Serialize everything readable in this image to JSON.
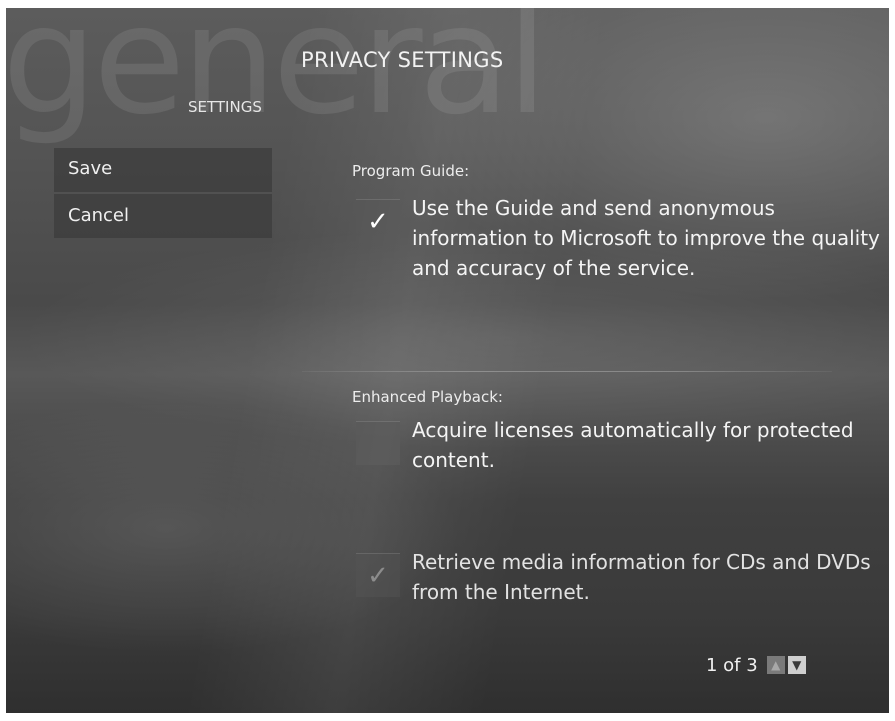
{
  "background_word": "general",
  "header": {
    "title": "PRIVACY SETTINGS",
    "section": "SETTINGS"
  },
  "menu": {
    "items": [
      {
        "label": "Save"
      },
      {
        "label": "Cancel"
      }
    ]
  },
  "groups": [
    {
      "label": "Program Guide:",
      "options": [
        {
          "text": "Use the Guide and send anonymous information to Microsoft to improve the quality and accuracy of the service.",
          "checked": true,
          "enabled": true
        }
      ]
    },
    {
      "label": "Enhanced Playback:",
      "options": [
        {
          "text": "Acquire licenses automatically for protected content.",
          "checked": false,
          "enabled": true
        },
        {
          "text": "Retrieve media information for CDs and DVDs from the Internet.",
          "checked": true,
          "enabled": false
        }
      ]
    }
  ],
  "pager": {
    "text": "1 of 3",
    "up_icon": "chevron-up-icon",
    "down_icon": "chevron-down-icon"
  },
  "colors": {
    "text": "#f4f4f4",
    "checkbox": "#505050"
  }
}
